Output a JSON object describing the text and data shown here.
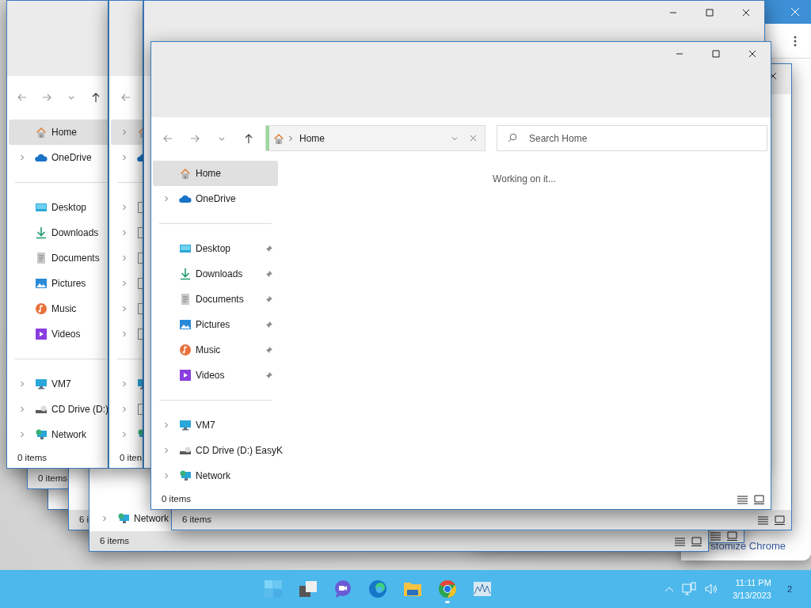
{
  "windows": [
    {
      "kind": "browser",
      "link": "stomize Chrome"
    },
    {
      "kind": "back",
      "view_icons": true
    },
    {
      "kind": "back"
    },
    {
      "kind": "back",
      "status": "0 items"
    },
    {
      "kind": "back",
      "status": "6 i"
    },
    {
      "kind": "back",
      "status": "6 items",
      "view_icons": true,
      "sidebar": [
        [
          {
            "label": "Network",
            "kind": "network",
            "expandable": true,
            "selected": false
          }
        ]
      ]
    },
    {
      "kind": "back",
      "status": "6 items",
      "view_icons": true,
      "caption": [
        {
          "kind": "close"
        }
      ]
    },
    {
      "kind": "explorer",
      "nav": [
        {
          "kind": "back"
        },
        {
          "kind": "forward"
        },
        {
          "kind": "recent"
        },
        {
          "kind": "up"
        }
      ],
      "status": "0 items",
      "sidebar": [
        [
          {
            "label": "Home",
            "kind": "home",
            "expandable": false,
            "selected": true
          },
          {
            "label": "OneDrive",
            "kind": "cloud",
            "expandable": true,
            "selected": false
          }
        ],
        [
          {
            "label": "Desktop",
            "kind": "desktop",
            "expandable": false,
            "selected": false
          },
          {
            "label": "Downloads",
            "kind": "download",
            "expandable": false,
            "selected": false
          },
          {
            "label": "Documents",
            "kind": "document",
            "expandable": false,
            "selected": false
          },
          {
            "label": "Pictures",
            "kind": "picture",
            "expandable": false,
            "selected": false
          },
          {
            "label": "Music",
            "kind": "music",
            "expandable": false,
            "selected": false
          },
          {
            "label": "Videos",
            "kind": "video",
            "expandable": false,
            "selected": false
          }
        ],
        [
          {
            "label": "VM7",
            "kind": "pc",
            "expandable": true,
            "selected": false
          },
          {
            "label": "CD Drive (D:)",
            "kind": "cd",
            "expandable": true,
            "selected": false
          },
          {
            "label": "Network",
            "kind": "network",
            "expandable": true,
            "selected": false
          }
        ]
      ]
    },
    {
      "kind": "explorer",
      "nav": [
        {
          "kind": "back"
        }
      ],
      "status": "0 iten",
      "sidebar": [
        [
          {
            "kind": "home",
            "expandable": true,
            "selected": true
          },
          {
            "kind": "cloud",
            "expandable": true,
            "selected": false
          }
        ],
        [
          {
            "kind": "blank",
            "expandable": true,
            "selected": false
          },
          {
            "kind": "blank",
            "expandable": true,
            "selected": false
          },
          {
            "kind": "blank",
            "expandable": true,
            "selected": false
          },
          {
            "kind": "blank",
            "expandable": true,
            "selected": false
          },
          {
            "kind": "blank",
            "expandable": true,
            "selected": false
          },
          {
            "kind": "blank",
            "expandable": true,
            "selected": false
          }
        ],
        [
          {
            "kind": "pc",
            "expandable": true,
            "selected": false
          },
          {
            "kind": "blank",
            "expandable": true,
            "selected": false
          },
          {
            "kind": "network",
            "expandable": true,
            "selected": false
          }
        ]
      ]
    },
    {
      "kind": "explorer",
      "caption": [
        {
          "kind": "minimize"
        },
        {
          "kind": "maximize"
        },
        {
          "kind": "close"
        }
      ]
    },
    {
      "kind": "explorer",
      "caption": [
        {
          "kind": "minimize"
        },
        {
          "kind": "maximize"
        },
        {
          "kind": "close"
        }
      ],
      "nav": [
        {
          "kind": "back"
        },
        {
          "kind": "forward"
        },
        {
          "kind": "recent"
        },
        {
          "kind": "up"
        }
      ],
      "address": {
        "location": "Home",
        "loading": true
      },
      "search": {
        "placeholder": "Search Home"
      },
      "content": "Working on it...",
      "status": "0 items",
      "view_icons": true,
      "sidebar": [
        [
          {
            "label": "Home",
            "kind": "home",
            "expandable": false,
            "selected": true,
            "pinned": false
          },
          {
            "label": "OneDrive",
            "kind": "cloud",
            "expandable": true,
            "selected": false,
            "pinned": false
          }
        ],
        [
          {
            "label": "Desktop",
            "kind": "desktop",
            "expandable": false,
            "selected": false,
            "pinned": true
          },
          {
            "label": "Downloads",
            "kind": "download",
            "expandable": false,
            "selected": false,
            "pinned": true
          },
          {
            "label": "Documents",
            "kind": "document",
            "expandable": false,
            "selected": false,
            "pinned": true
          },
          {
            "label": "Pictures",
            "kind": "picture",
            "expandable": false,
            "selected": false,
            "pinned": true
          },
          {
            "label": "Music",
            "kind": "music",
            "expandable": false,
            "selected": false,
            "pinned": true
          },
          {
            "label": "Videos",
            "kind": "video",
            "expandable": false,
            "selected": false,
            "pinned": true
          }
        ],
        [
          {
            "label": "VM7",
            "kind": "pc",
            "expandable": true,
            "selected": false,
            "pinned": false
          },
          {
            "label": "CD Drive (D:) EasyK",
            "kind": "cd",
            "expandable": true,
            "selected": false,
            "pinned": false
          },
          {
            "label": "Network",
            "kind": "network",
            "expandable": true,
            "selected": false,
            "pinned": false
          }
        ]
      ]
    }
  ],
  "taskbar": {
    "apps": [
      {
        "kind": "start",
        "running": false
      },
      {
        "kind": "taskview",
        "running": false
      },
      {
        "kind": "chat",
        "running": false
      },
      {
        "kind": "edge",
        "running": false
      },
      {
        "kind": "folder",
        "running": false
      },
      {
        "kind": "chrome",
        "running": true
      },
      {
        "kind": "monitor",
        "running": false
      }
    ],
    "time": "11:11 PM",
    "date": "3/13/2023",
    "notifications": "2"
  }
}
